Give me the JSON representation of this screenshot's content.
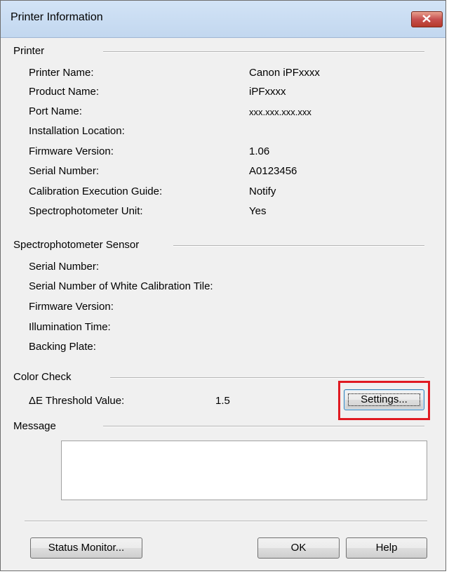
{
  "window": {
    "title": "Printer Information"
  },
  "printer_group": {
    "title": "Printer",
    "rows": [
      {
        "label": "Printer Name:",
        "value": "Canon iPFxxxx"
      },
      {
        "label": "Product Name:",
        "value": "iPFxxxx"
      },
      {
        "label": "Port Name:",
        "value": "xxx.xxx.xxx.xxx"
      },
      {
        "label": "Installation Location:",
        "value": ""
      },
      {
        "label": "Firmware Version:",
        "value": "1.06"
      },
      {
        "label": "Serial Number:",
        "value": "A0123456"
      },
      {
        "label": "Calibration Execution Guide:",
        "value": "Notify"
      },
      {
        "label": "Spectrophotometer Unit:",
        "value": "Yes"
      }
    ]
  },
  "sensor_group": {
    "title": "Spectrophotometer Sensor",
    "rows": [
      {
        "label": "Serial Number:"
      },
      {
        "label": "Serial Number of White Calibration Tile:"
      },
      {
        "label": "Firmware Version:"
      },
      {
        "label": "Illumination Time:"
      },
      {
        "label": "Backing Plate:"
      }
    ]
  },
  "color_check": {
    "title": "Color Check",
    "threshold_label": "ΔE Threshold Value:",
    "threshold_value": "1.5",
    "settings_button": "Settings..."
  },
  "message_group": {
    "title": "Message",
    "text": ""
  },
  "footer": {
    "status_monitor_button": "Status Monitor...",
    "ok_button": "OK",
    "help_button": "Help"
  },
  "colors": {
    "highlight": "#e01a22",
    "close_button": "#c75050"
  }
}
